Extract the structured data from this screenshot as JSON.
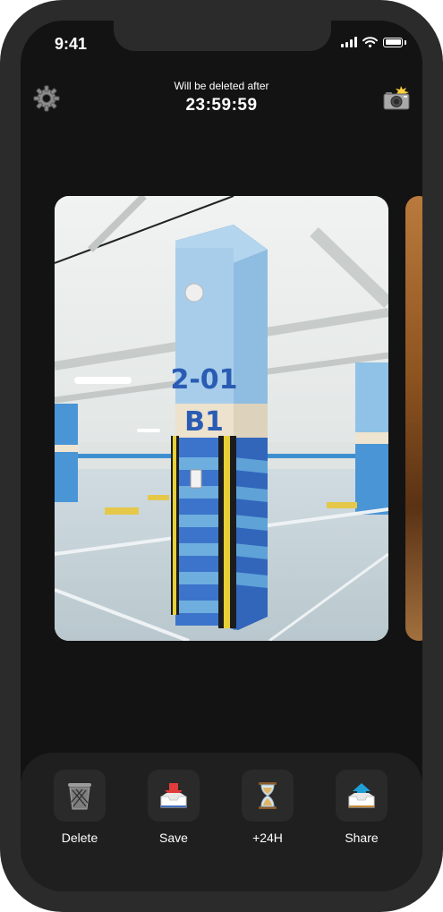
{
  "status_bar": {
    "time": "9:41"
  },
  "header": {
    "caption": "Will be deleted after",
    "timer": "23:59:59",
    "settings_icon": "gear-icon",
    "camera_icon": "camera-flash-icon"
  },
  "photo": {
    "pillar_number": "2-01",
    "pillar_level": "B1"
  },
  "actions": [
    {
      "label": "Delete",
      "icon": "trash-icon"
    },
    {
      "label": "Save",
      "icon": "inbox-download-icon"
    },
    {
      "label": "+24H",
      "icon": "hourglass-icon"
    },
    {
      "label": "Share",
      "icon": "outbox-upload-icon"
    }
  ],
  "colors": {
    "background": "#131313",
    "frame": "#2b2b2b",
    "toolbar": "#1f1f1f",
    "tile": "#2a2a2a",
    "text": "#ffffff"
  }
}
